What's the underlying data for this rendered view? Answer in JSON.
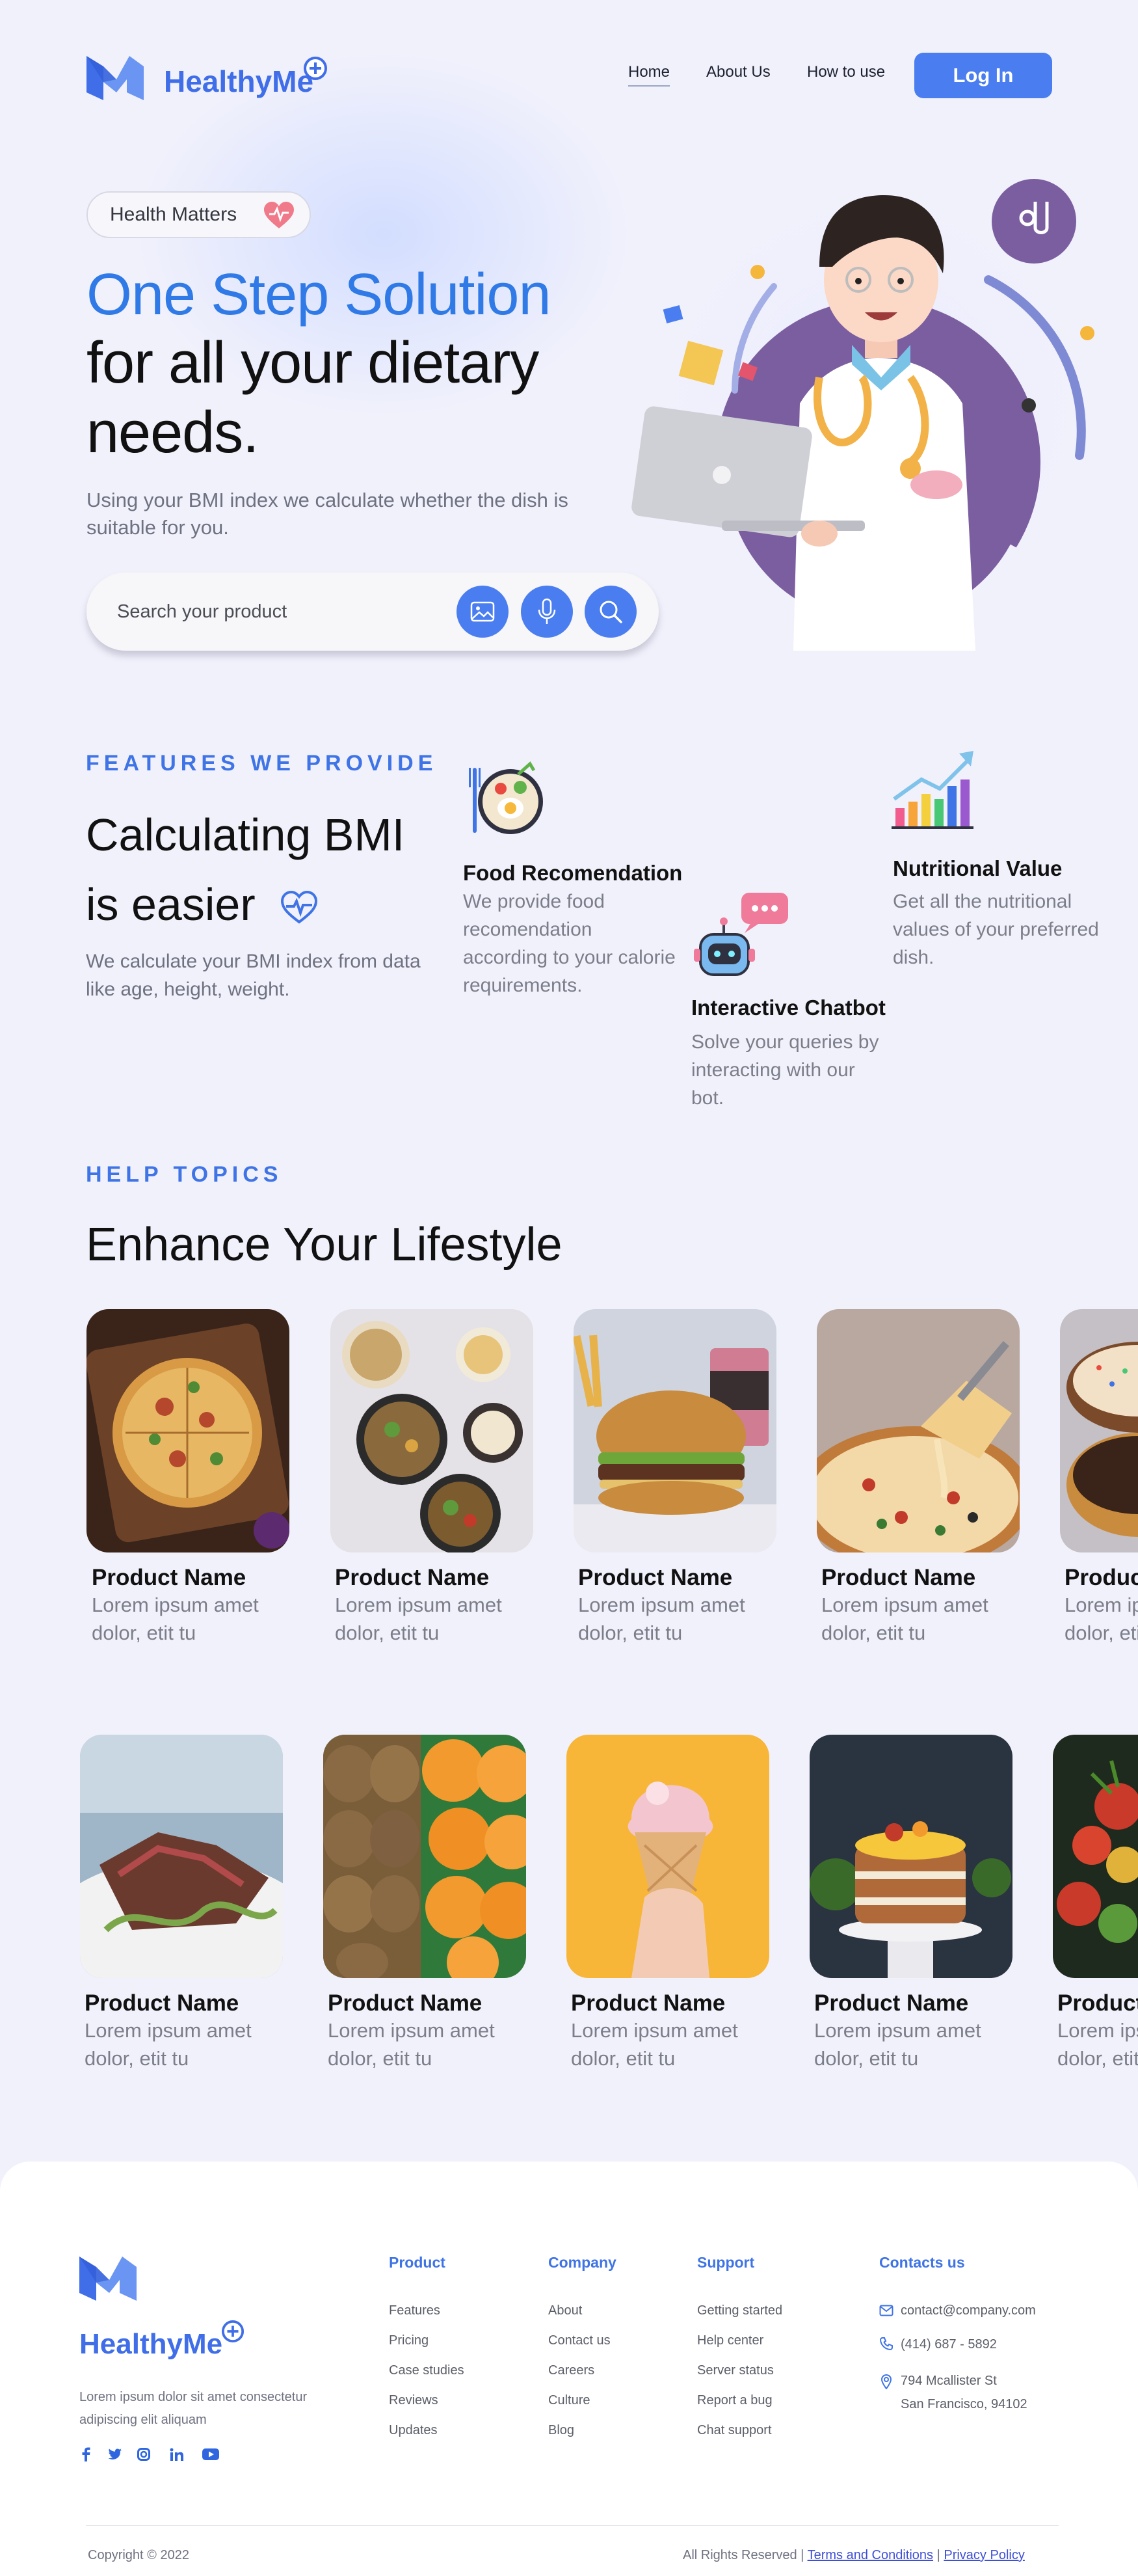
{
  "brand": {
    "name": "HealthyMe",
    "accent": "#4a7df0",
    "title_blue": "#2f7ae6"
  },
  "nav": {
    "items": [
      "Home",
      "About Us",
      "How to use"
    ],
    "login": "Log In"
  },
  "hero": {
    "badge": "Health Matters",
    "title_line1": "One Step Solution",
    "title_line2": "for all your dietary",
    "title_line3": "needs.",
    "subtitle": "Using your BMI index we calculate whether the dish is suitable for you.",
    "search_placeholder": "Search your product",
    "search_icons": [
      "image-icon",
      "microphone-icon",
      "search-icon"
    ]
  },
  "features": {
    "kicker": "FEATURES WE PROVIDE",
    "title_line1": "Calculating BMI",
    "title_line2": "is easier",
    "subtitle": "We calculate your BMI index from data like age, height, weight.",
    "cards": [
      {
        "title": "Food Recomendation",
        "desc": "We provide food recomendation according to your calorie requirements.",
        "icon": "food-bowl-icon"
      },
      {
        "title": "Interactive Chatbot",
        "desc": "Solve your queries by interacting with our bot.",
        "icon": "robot-chat-icon"
      },
      {
        "title": "Nutritional Value",
        "desc": "Get all the nutritional values of your preferred dish.",
        "icon": "bar-chart-growth-icon"
      }
    ]
  },
  "help": {
    "kicker": "HELP TOPICS",
    "title": "Enhance Your Lifestyle",
    "row1": [
      {
        "name": "Product Name",
        "desc": "Lorem ipsum amet dolor, etit tu",
        "image": "pizza-photo"
      },
      {
        "name": "Product Name",
        "desc": "Lorem ipsum amet dolor, etit tu",
        "image": "bowls-photo"
      },
      {
        "name": "Product Name",
        "desc": "Lorem ipsum amet dolor, etit tu",
        "image": "burger-photo"
      },
      {
        "name": "Product Name",
        "desc": "Lorem ipsum amet dolor, etit tu",
        "image": "cheese-pizza-photo"
      },
      {
        "name": "Product Name",
        "desc": "Lorem ipsum amet dolor, etit tu",
        "image": "donut-photo"
      }
    ],
    "row2": [
      {
        "name": "Product Name",
        "desc": "Lorem ipsum amet dolor, etit tu",
        "image": "steak-photo"
      },
      {
        "name": "Product Name",
        "desc": "Lorem ipsum amet dolor, etit tu",
        "image": "fruit-crate-photo"
      },
      {
        "name": "Product Name",
        "desc": "Lorem ipsum amet dolor, etit tu",
        "image": "ice-cream-photo"
      },
      {
        "name": "Product Name",
        "desc": "Lorem ipsum amet dolor, etit tu",
        "image": "cake-photo"
      },
      {
        "name": "Product Name",
        "desc": "Lorem ipsum amet dolor, etit tu",
        "image": "vegetables-photo"
      }
    ]
  },
  "footer": {
    "brand": "HealthyMe",
    "about": "Lorem ipsum dolor sit amet consectetur adipiscing elit aliquam",
    "social": [
      "facebook-icon",
      "twitter-icon",
      "instagram-icon",
      "linkedin-icon",
      "youtube-icon"
    ],
    "columns": [
      {
        "heading": "Product",
        "links": [
          "Features",
          "Pricing",
          "Case studies",
          "Reviews",
          "Updates"
        ]
      },
      {
        "heading": "Company",
        "links": [
          "About",
          "Contact us",
          "Careers",
          "Culture",
          "Blog"
        ]
      },
      {
        "heading": "Support",
        "links": [
          "Getting started",
          "Help center",
          "Server status",
          "Report a bug",
          "Chat support"
        ]
      }
    ],
    "contacts": {
      "heading": "Contacts us",
      "email": "contact@company.com",
      "phone": "(414) 687 - 5892",
      "address_line1": "794 Mcallister St",
      "address_line2": "San Francisco, 94102"
    },
    "copyright": "Copyright © 2022",
    "rights": "All Rights Reserved |",
    "terms": "Terms and Conditions",
    "sep": "|",
    "privacy": "Privacy Policy"
  }
}
